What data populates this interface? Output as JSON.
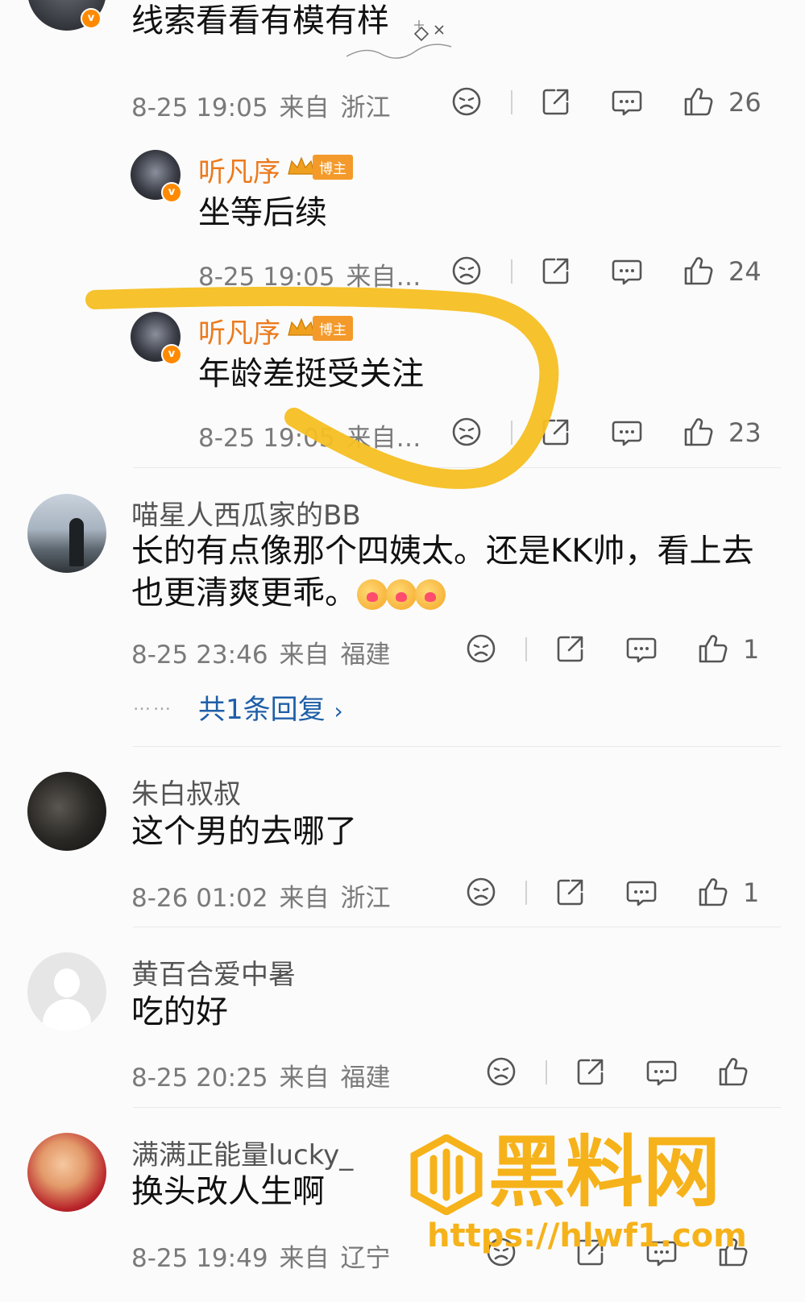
{
  "colors": {
    "blogger_name": "#ec7a1c",
    "reply_link": "#1f5fa8",
    "highlight_stroke": "#f6bf22",
    "watermark": "#f6b21a"
  },
  "top_comment": {
    "text": "线索看看有模有样",
    "time": "8-25 19:05",
    "from": "来自",
    "region": "浙江",
    "likes": "26"
  },
  "replies": [
    {
      "user": "听凡序",
      "badge": "博主",
      "text": "坐等后续",
      "time": "8-25 19:05",
      "from": "来自…",
      "likes": "24"
    },
    {
      "user": "听凡序",
      "badge": "博主",
      "text": "年龄差挺受关注",
      "time": "8-25 19:05",
      "from": "来自…",
      "likes": "23"
    }
  ],
  "comments": [
    {
      "user": "喵星人西瓜家的BB",
      "text_line1": "长的有点像那个四姨太。还是KK帅，看上去",
      "text_line2": "也更清爽更乖。",
      "emojis": [
        "heart-face-emoji",
        "heart-face-emoji",
        "heart-face-emoji"
      ],
      "time": "8-25 23:46",
      "from": "来自",
      "region": "福建",
      "likes": "1",
      "reply_link": "共1条回复",
      "reply_dots": "……"
    },
    {
      "user": "朱白叔叔",
      "text": "这个男的去哪了",
      "time": "8-26 01:02",
      "from": "来自",
      "region": "浙江",
      "likes": "1"
    },
    {
      "user": "黄百合爱中暑",
      "text": "吃的好",
      "time": "8-25 20:25",
      "from": "来自",
      "region": "福建",
      "likes": ""
    },
    {
      "user": "满满正能量lucky_",
      "text": "换头改人生啊",
      "time": "8-25 19:49",
      "from": "来自",
      "region": "辽宁",
      "likes": ""
    }
  ],
  "watermark": {
    "title": "黑料网",
    "url": "https://hlwf1.com"
  },
  "icons": [
    "dislike-icon",
    "share-icon",
    "comment-icon",
    "like-icon"
  ]
}
